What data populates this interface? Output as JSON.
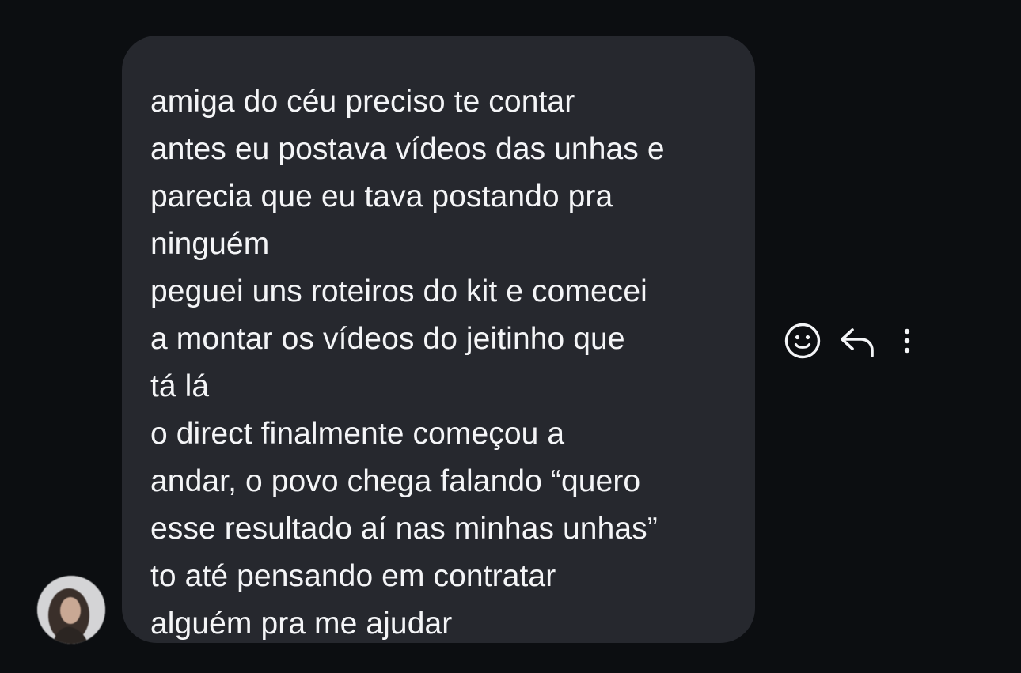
{
  "message": {
    "lines": [
      "amiga do céu preciso te contar",
      "antes eu postava vídeos das unhas e",
      "parecia que eu tava postando pra",
      "ninguém",
      "peguei uns roteiros do kit e comecei",
      "a montar os vídeos do jeitinho que",
      "tá lá",
      "o direct finalmente começou a",
      "andar, o povo chega falando “quero",
      "esse resultado aí nas minhas unhas”",
      "to até pensando em contratar",
      "alguém pra me ajudar"
    ]
  },
  "actions": {
    "react_icon": "smiley-icon",
    "reply_icon": "reply-arrow-icon",
    "more_icon": "more-vertical-icon"
  },
  "colors": {
    "background": "#0c0e11",
    "bubble": "#26282e",
    "text": "#f4f5f7",
    "icon": "#f4f5f7"
  }
}
